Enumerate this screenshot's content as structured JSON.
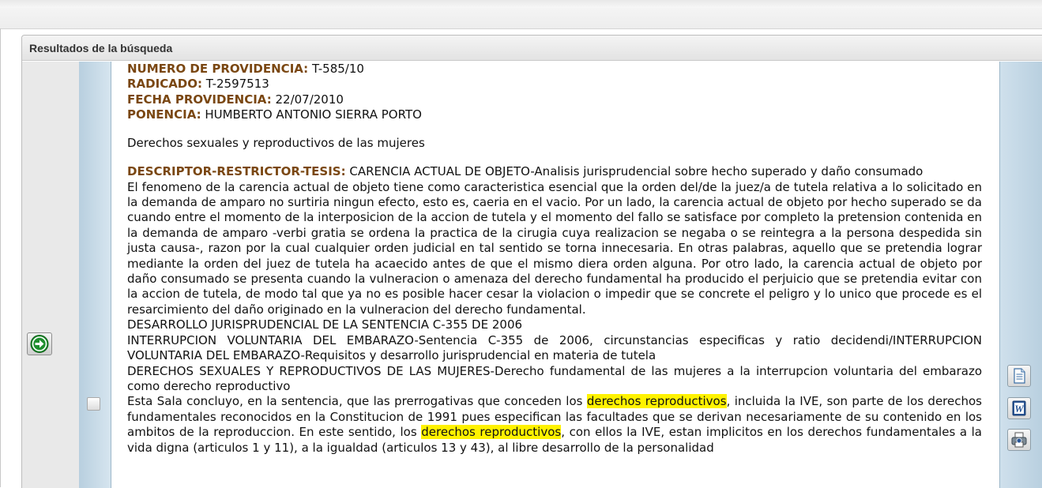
{
  "panel": {
    "title": "Resultados de la búsqueda"
  },
  "record": {
    "numero_label": "NUMERO DE PROVIDENCIA:",
    "numero_value": "T-585/10",
    "radicado_label": "RADICADO:",
    "radicado_value": "T-2597513",
    "fecha_label": "FECHA PROVIDENCIA:",
    "fecha_value": "22/07/2010",
    "ponencia_label": "PONENCIA:",
    "ponencia_value": "HUMBERTO ANTONIO SIERRA PORTO",
    "tema": "Derechos sexuales y reproductivos de las mujeres",
    "descriptor_label": "DESCRIPTOR-RESTRICTOR-TESIS:",
    "descriptor_value": "CARENCIA ACTUAL DE OBJETO-Analisis jurisprudencial sobre hecho superado y daño consumado",
    "p1": "El fenomeno de la carencia actual de objeto tiene como caracteristica esencial que la orden del/de la juez/a de tutela relativa a lo solicitado en la demanda de amparo no surtiria ningun efecto, esto es, caeria en el vacio. Por un lado, la carencia actual de objeto por hecho superado se da cuando entre el momento de la interposicion de la accion de tutela y el momento del fallo se satisface por completo la pretension contenida en la demanda de amparo -verbi gratia se ordena la practica de la cirugia cuya realizacion se negaba o se reintegra a la persona despedida sin justa causa-, razon por la cual cualquier orden judicial en tal sentido se torna innecesaria. En otras palabras, aquello que se pretendia lograr mediante la orden del juez de tutela ha acaecido antes de que el mismo diera orden alguna. Por otro lado, la carencia actual de objeto por daño consumado se presenta cuando la vulneracion o amenaza del derecho fundamental ha producido el perjuicio que se pretendia evitar con la accion de tutela, de modo tal que ya no es posible hacer cesar la violacion o impedir que se concrete el peligro y lo unico que procede es el resarcimiento del daño originado en la vulneracion del derecho fundamental.",
    "p2": "DESARROLLO JURISPRUDENCIAL DE LA SENTENCIA C-355 DE 2006",
    "p3": "INTERRUPCION VOLUNTARIA DEL EMBARAZO-Sentencia C-355 de 2006, circunstancias especificas y ratio decidendi/INTERRUPCION VOLUNTARIA DEL EMBARAZO-Requisitos y desarrollo jurisprudencial en materia de tutela",
    "p4": "DERECHOS SEXUALES Y REPRODUCTIVOS DE LAS MUJERES-Derecho fundamental de las mujeres a la interrupcion voluntaria del embarazo como derecho reproductivo",
    "p5_a": "Esta Sala concluyo, en la sentencia, que las prerrogativas que conceden los ",
    "p5_hl1": "derechos reproductivos",
    "p5_b": ", incluida la IVE, son parte de los derechos fundamentales reconocidos en la Constitucion de 1991 pues especifican las facultades que se derivan necesariamente de su contenido en los ambitos de la reproduccion. En este sentido, los ",
    "p5_hl2": "derechos reproductivos",
    "p5_c": ", con ellos la IVE, estan implicitos en los derechos fundamentales a la vida digna (articulos 1 y 11), a la igualdad (articulos 13 y 43), al libre desarrollo de la personalidad"
  },
  "colors": {
    "label_brown": "#7a4712",
    "highlight": "#fff200",
    "strip_blue": "#c4d8e6"
  },
  "icons": {
    "go": "arrow-right-circle-icon",
    "document": "document-icon",
    "word": "word-icon",
    "print": "printer-icon"
  }
}
